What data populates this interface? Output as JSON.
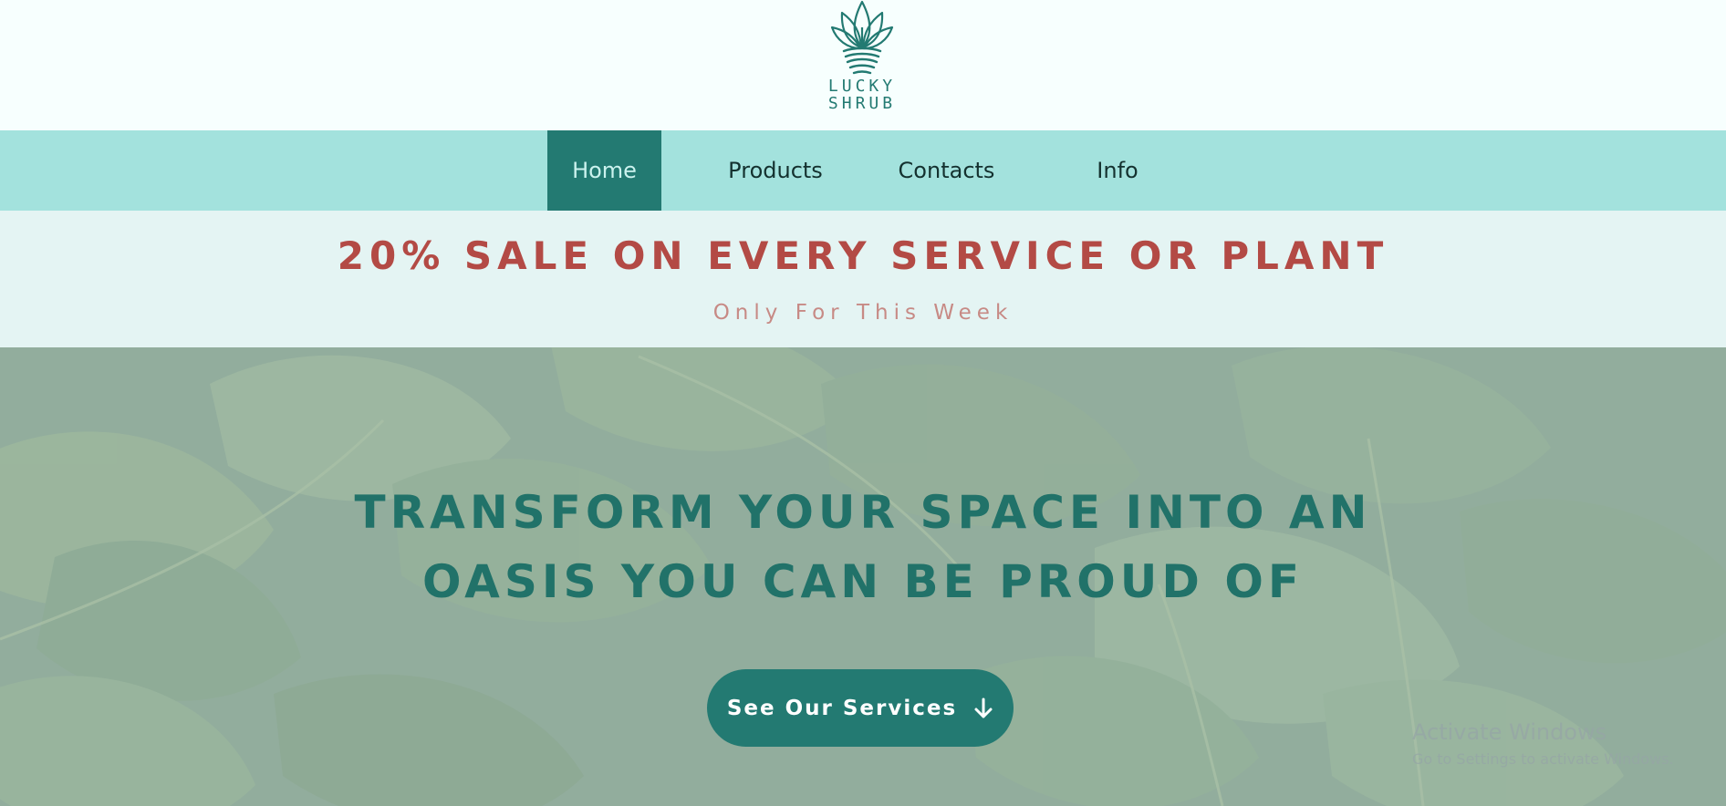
{
  "logo": {
    "name": "lucky-shrub-logo",
    "text_line1": "LUCKY",
    "text_line2": "SHRUB"
  },
  "nav": {
    "items": [
      {
        "label": "Home",
        "active": true
      },
      {
        "label": "Products",
        "active": false
      },
      {
        "label": "Contacts",
        "active": false
      },
      {
        "label": "Info",
        "active": false
      }
    ]
  },
  "promo": {
    "title": "20% SALE ON EVERY SERVICE OR PLANT",
    "subtitle": "Only For This Week"
  },
  "hero": {
    "heading_line1": "TRANSFORM YOUR SPACE INTO AN",
    "heading_line2": "OASIS YOU CAN BE PROUD OF",
    "cta_label": "See Our Services",
    "cta_icon": "arrow-down-icon",
    "background": "monstera-leaves-image"
  },
  "watermark": {
    "title": "Activate Windows",
    "subtitle": "Go to Settings to activate Windows."
  },
  "colors": {
    "brand": "#237a72",
    "nav_bg": "#a3e2dd",
    "promo_bg": "#e4f4f3",
    "promo_title": "#b34a45",
    "promo_subtitle": "#c78a85"
  }
}
